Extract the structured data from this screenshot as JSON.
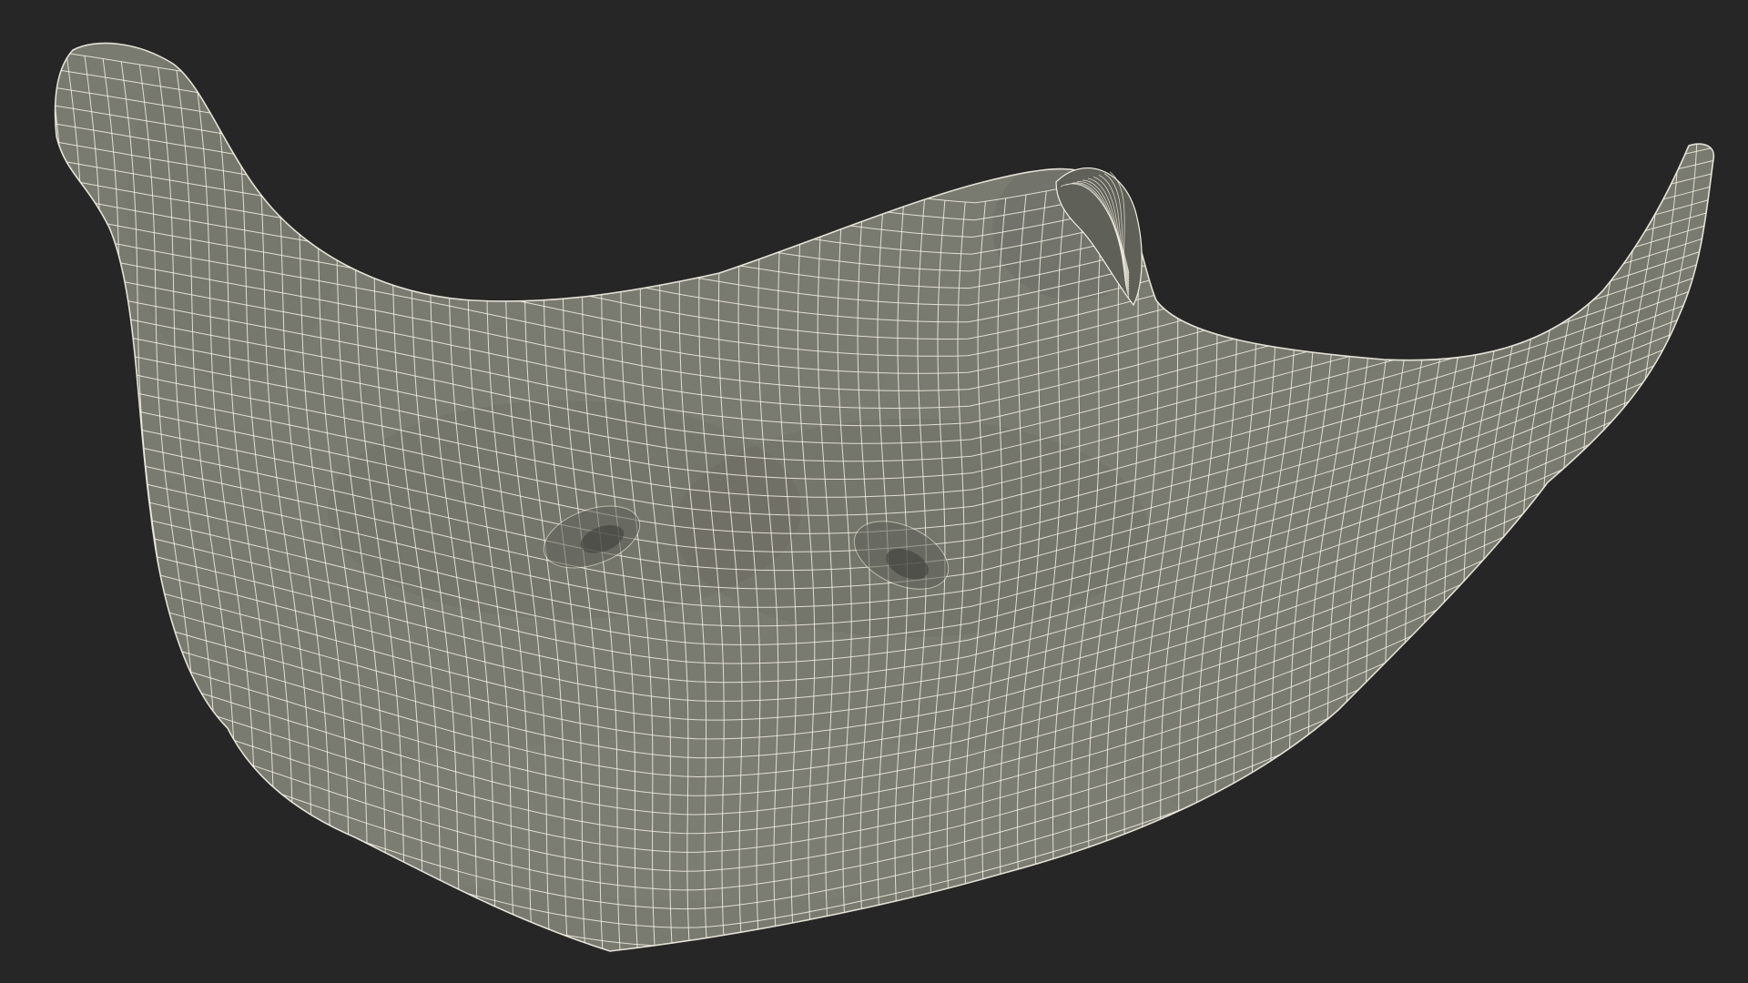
{
  "scene": {
    "background_color": "#262626",
    "model_fill_color": "#797a70",
    "model_shadow_color": "#5f6058",
    "wireframe_color": "#f4f1e4",
    "display_mode": "wireframe-on-shaded",
    "subject_icon": "manta-ray-mesh-icon"
  }
}
